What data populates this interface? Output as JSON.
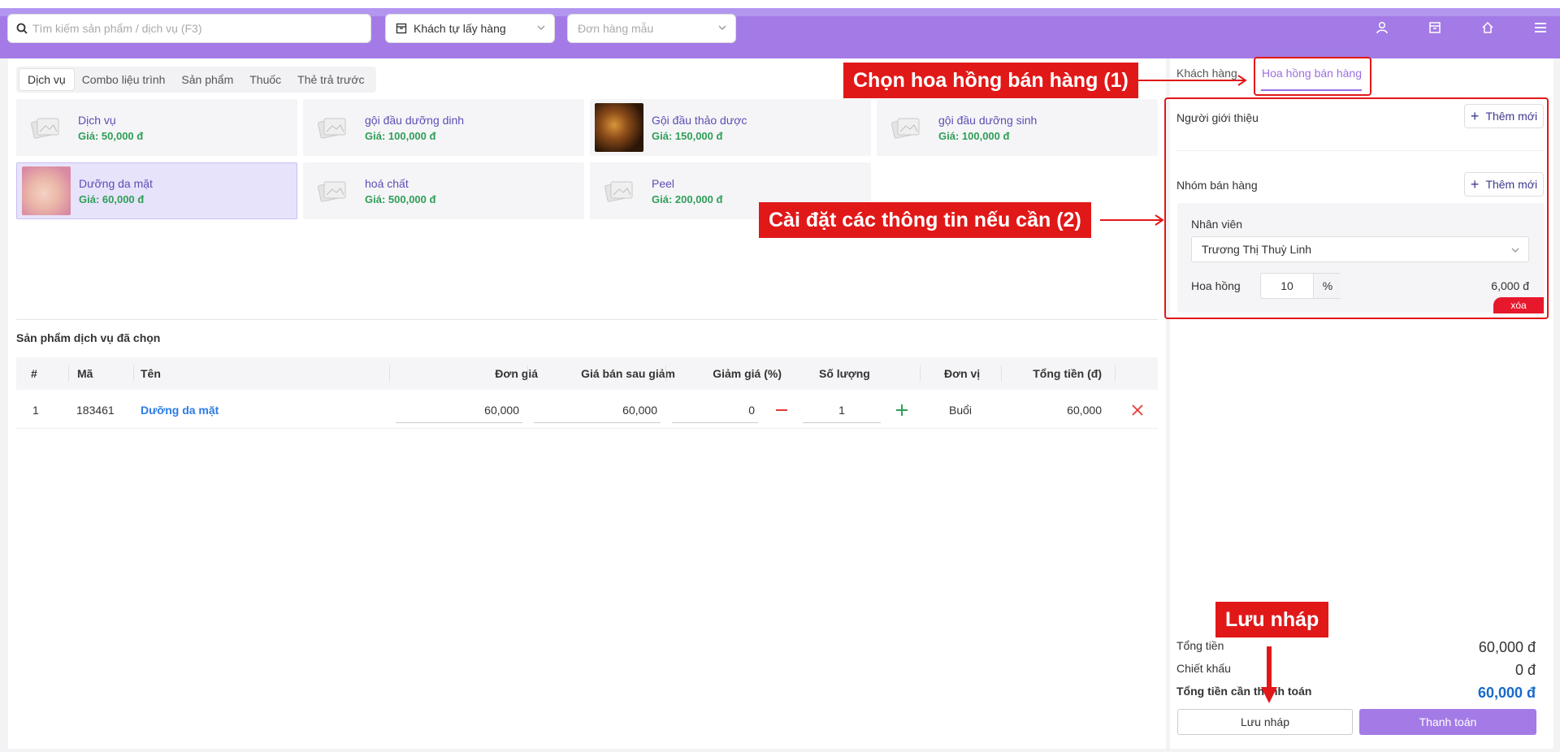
{
  "topbar": {
    "search_placeholder": "Tìm kiếm sản phẩm / dịch vụ (F3)",
    "delivery_select": "Khách tự lấy hàng",
    "template_placeholder": "Đơn hàng mẫu",
    "icons": [
      "user-icon",
      "store-icon",
      "home-icon",
      "menu-icon"
    ]
  },
  "category_tabs": [
    {
      "label": "Dịch vụ"
    },
    {
      "label": "Combo liệu trình"
    },
    {
      "label": "Sản phẩm"
    },
    {
      "label": "Thuốc"
    },
    {
      "label": "Thẻ trả trước"
    }
  ],
  "products": [
    {
      "name": "Dịch vụ",
      "price": "Giá: 50,000 đ"
    },
    {
      "name": "gội đầu dưỡng dinh",
      "price": "Giá: 100,000 đ"
    },
    {
      "name": "Gội đầu thảo dược",
      "price": "Giá: 150,000 đ"
    },
    {
      "name": "gội đầu dưỡng sinh",
      "price": "Giá: 100,000 đ"
    },
    {
      "name": "Dưỡng da mặt",
      "price": "Giá: 60,000 đ"
    },
    {
      "name": "hoá chất",
      "price": "Giá: 500,000 đ"
    },
    {
      "name": "Peel",
      "price": "Giá: 200,000 đ"
    }
  ],
  "selected_section": {
    "title": "Sản phẩm dịch vụ đã chọn",
    "headers": {
      "idx": "#",
      "code": "Mã",
      "name": "Tên",
      "unit_price": "Đơn giá",
      "sale_price": "Giá bán sau giảm",
      "discount": "Giảm giá (%)",
      "qty": "Số lượng",
      "unit": "Đơn vị",
      "total": "Tổng tiền (đ)"
    },
    "rows": [
      {
        "idx": "1",
        "code": "183461",
        "name": "Dưỡng da mặt",
        "unit_price": "60,000",
        "sale_price": "60,000",
        "discount": "0",
        "qty": "1",
        "unit": "Buổi",
        "total": "60,000"
      }
    ]
  },
  "right_panel": {
    "tab_customer": "Khách hàng",
    "tab_commission": "Hoa hồng bán hàng",
    "referrer_label": "Người giới thiệu",
    "add_label": "Thêm mới",
    "sales_group_label": "Nhóm bán hàng",
    "staff_label": "Nhân viên",
    "staff_value": "Trương Thị Thuỳ Linh",
    "commission_label": "Hoa hồng",
    "commission_value": "10",
    "commission_unit": "%",
    "commission_amount": "6,000 đ",
    "delete_label": "xóa"
  },
  "totals": {
    "total_label": "Tổng tiền",
    "total_value": "60,000 đ",
    "discount_label": "Chiết khấu",
    "discount_value": "0 đ",
    "due_label": "Tổng tiền cần thanh toán",
    "due_value": "60,000 đ",
    "save_draft": "Lưu nháp",
    "pay": "Thanh toán"
  },
  "annotations": {
    "step1": "Chọn hoa hồng bán hàng (1)",
    "step2": "Cài đặt các thông tin nếu cần (2)",
    "draft": "Lưu nháp"
  },
  "colors": {
    "brand": "#a47be6",
    "annotation": "#e11818",
    "price": "#2f9e57",
    "link": "#2c7be5"
  }
}
